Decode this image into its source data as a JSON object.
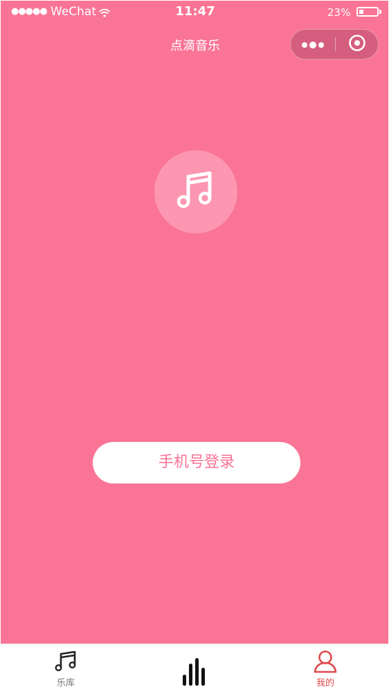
{
  "status_bar": {
    "signal": "●●●●●",
    "carrier": "WeChat",
    "time": "11:47",
    "battery_percent": "23%",
    "battery_level": 0.23
  },
  "nav": {
    "title": "点滴音乐",
    "more_icon": "more-dots-icon",
    "close_icon": "target-close-icon"
  },
  "login": {
    "button_label": "手机号登录"
  },
  "logo": {
    "icon": "music-note-icon"
  },
  "tab_bar": {
    "items": [
      {
        "label": "乐库",
        "icon": "music-note-icon"
      },
      {
        "label": "",
        "icon": "equalizer-bars-icon"
      },
      {
        "label": "我的",
        "icon": "user-icon",
        "active": true
      }
    ]
  },
  "colors": {
    "background": "#fa7495",
    "logo_circle": "#fc96b1",
    "button_text": "#f87396",
    "active_tab": "#e0494c"
  }
}
